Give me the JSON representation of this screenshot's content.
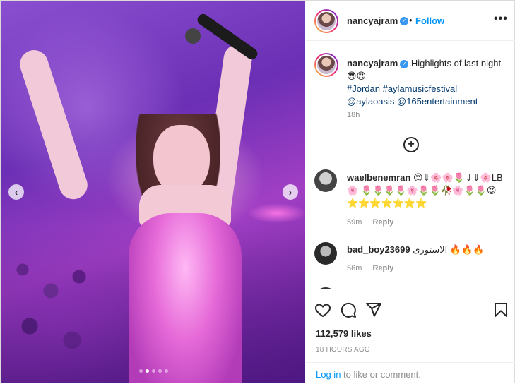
{
  "header": {
    "username": "nancyajram",
    "dot": "•",
    "follow_label": "Follow",
    "more_label": "•••"
  },
  "caption": {
    "username": "nancyajram",
    "text": "Highlights of last night 😎😍",
    "tag_line_1": "#Jordan #aylamusicfestival",
    "tag_line_2": "@aylaoasis @165entertainment",
    "time": "18h"
  },
  "load_more_label": "+",
  "comments": [
    {
      "username": "waelbenemran",
      "text": "😍⇓🌸🌸🌷⇓⇓🌸LB🌸 🌷🌷🌷🌷🌸🌷🌷🥀🌸🌷🌷😍 ⭐⭐⭐⭐⭐⭐⭐",
      "time": "59m",
      "reply_label": "Reply"
    },
    {
      "username": "bad_boy23699",
      "text": "الاستورى 🔥🔥🔥",
      "time": "56m",
      "reply_label": "Reply"
    }
  ],
  "actions": {
    "likes": "112,579 likes",
    "date": "18 HOURS AGO",
    "login_link": "Log in",
    "login_suffix": " to like or comment."
  },
  "media": {
    "prev_label": "‹",
    "next_label": "›",
    "slide_count": 5,
    "active_slide": 1
  },
  "colors": {
    "accent": "#0095f6",
    "verified": "#3897f0",
    "tag": "#00376b",
    "muted": "#8e8e8e"
  },
  "icons": [
    "heart-icon",
    "comment-icon",
    "share-icon",
    "bookmark-icon",
    "verified-icon",
    "more-icon",
    "add-circle-icon",
    "chevron-left-icon",
    "chevron-right-icon"
  ]
}
